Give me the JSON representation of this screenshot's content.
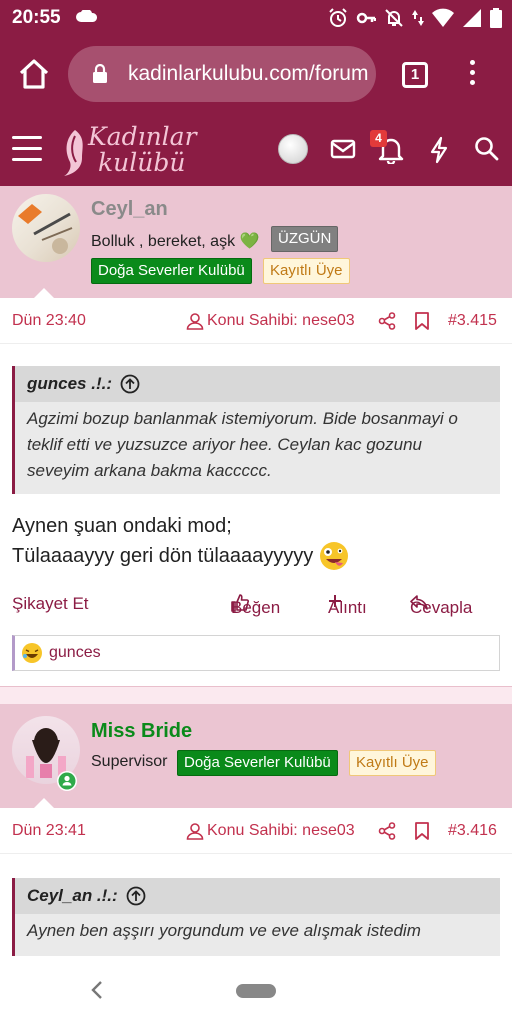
{
  "status_bar": {
    "time": "20:55"
  },
  "browser": {
    "url": "kadinlarkulubu.com/forum",
    "tab_count": "1"
  },
  "site": {
    "logo_line1": "Kadınlar",
    "logo_line2": "kulübü",
    "notification_count": "4"
  },
  "posts": [
    {
      "username": "Ceyl_an",
      "username_color": "#8a8a8a",
      "user_title": "Bolluk , bereket, aşk 💚",
      "badges": [
        "ÜZGÜN",
        "Doğa Severler Kulübü",
        "Kayıtlı Üye"
      ],
      "date": "Dün 23:40",
      "thread_owner": "Konu Sahibi: nese03",
      "post_number": "#3.415",
      "quote_author": "gunces .!.:",
      "quote_text": "Agzimi bozup banlanmak istemiyorum. Bide bosanmayi o teklif etti ve yuzsuzce ariyor hee. Ceylan kac gozunu seveyim arkana bakma kaccccc.",
      "message_line1": "Aynen şuan ondaki mod;",
      "message_line2": "Tülaaaayyy geri dön tülaaaayyyyy",
      "actions": {
        "report": "Şikayet Et",
        "like": "Beğen",
        "quote": "Alıntı",
        "reply": "Cevapla"
      },
      "reaction_user": "gunces"
    },
    {
      "username": "Miss Bride",
      "username_color": "#0a8a1a",
      "user_title": "Supervisor",
      "badges": [
        "Doğa Severler Kulübü",
        "Kayıtlı Üye"
      ],
      "date": "Dün 23:41",
      "thread_owner": "Konu Sahibi: nese03",
      "post_number": "#3.416",
      "quote_author": "Ceyl_an .!.:",
      "quote_text": "Aynen ben aşşırı yorgundum ve eve alışmak istedim"
    }
  ],
  "colors": {
    "brand": "#8b1c44",
    "header_pink": "#ebc5d2",
    "accent_red": "#c2314e"
  }
}
